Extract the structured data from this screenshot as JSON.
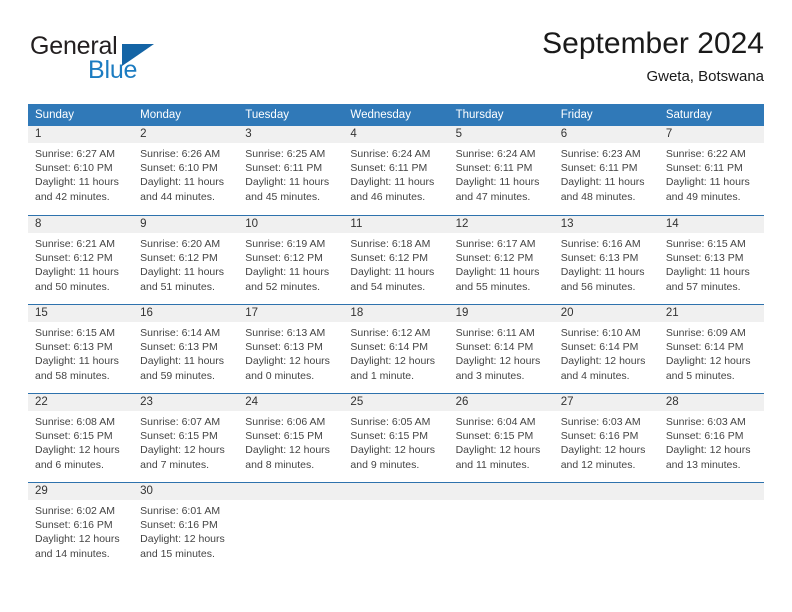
{
  "brand": {
    "name_part1": "General",
    "name_part2": "Blue",
    "triangle_color": "#1464a5",
    "blue_text_color": "#1c7cc1"
  },
  "header": {
    "title": "September 2024",
    "subtitle": "Gweta, Botswana"
  },
  "theme": {
    "header_blue": "#3079b8",
    "row_rule_blue": "#2e72ad",
    "day_band_gray": "#f0f0f0"
  },
  "weekdays": [
    "Sunday",
    "Monday",
    "Tuesday",
    "Wednesday",
    "Thursday",
    "Friday",
    "Saturday"
  ],
  "weeks": [
    [
      {
        "day": "1",
        "l1": "Sunrise: 6:27 AM",
        "l2": "Sunset: 6:10 PM",
        "l3": "Daylight: 11 hours",
        "l4": "and 42 minutes."
      },
      {
        "day": "2",
        "l1": "Sunrise: 6:26 AM",
        "l2": "Sunset: 6:10 PM",
        "l3": "Daylight: 11 hours",
        "l4": "and 44 minutes."
      },
      {
        "day": "3",
        "l1": "Sunrise: 6:25 AM",
        "l2": "Sunset: 6:11 PM",
        "l3": "Daylight: 11 hours",
        "l4": "and 45 minutes."
      },
      {
        "day": "4",
        "l1": "Sunrise: 6:24 AM",
        "l2": "Sunset: 6:11 PM",
        "l3": "Daylight: 11 hours",
        "l4": "and 46 minutes."
      },
      {
        "day": "5",
        "l1": "Sunrise: 6:24 AM",
        "l2": "Sunset: 6:11 PM",
        "l3": "Daylight: 11 hours",
        "l4": "and 47 minutes."
      },
      {
        "day": "6",
        "l1": "Sunrise: 6:23 AM",
        "l2": "Sunset: 6:11 PM",
        "l3": "Daylight: 11 hours",
        "l4": "and 48 minutes."
      },
      {
        "day": "7",
        "l1": "Sunrise: 6:22 AM",
        "l2": "Sunset: 6:11 PM",
        "l3": "Daylight: 11 hours",
        "l4": "and 49 minutes."
      }
    ],
    [
      {
        "day": "8",
        "l1": "Sunrise: 6:21 AM",
        "l2": "Sunset: 6:12 PM",
        "l3": "Daylight: 11 hours",
        "l4": "and 50 minutes."
      },
      {
        "day": "9",
        "l1": "Sunrise: 6:20 AM",
        "l2": "Sunset: 6:12 PM",
        "l3": "Daylight: 11 hours",
        "l4": "and 51 minutes."
      },
      {
        "day": "10",
        "l1": "Sunrise: 6:19 AM",
        "l2": "Sunset: 6:12 PM",
        "l3": "Daylight: 11 hours",
        "l4": "and 52 minutes."
      },
      {
        "day": "11",
        "l1": "Sunrise: 6:18 AM",
        "l2": "Sunset: 6:12 PM",
        "l3": "Daylight: 11 hours",
        "l4": "and 54 minutes."
      },
      {
        "day": "12",
        "l1": "Sunrise: 6:17 AM",
        "l2": "Sunset: 6:12 PM",
        "l3": "Daylight: 11 hours",
        "l4": "and 55 minutes."
      },
      {
        "day": "13",
        "l1": "Sunrise: 6:16 AM",
        "l2": "Sunset: 6:13 PM",
        "l3": "Daylight: 11 hours",
        "l4": "and 56 minutes."
      },
      {
        "day": "14",
        "l1": "Sunrise: 6:15 AM",
        "l2": "Sunset: 6:13 PM",
        "l3": "Daylight: 11 hours",
        "l4": "and 57 minutes."
      }
    ],
    [
      {
        "day": "15",
        "l1": "Sunrise: 6:15 AM",
        "l2": "Sunset: 6:13 PM",
        "l3": "Daylight: 11 hours",
        "l4": "and 58 minutes."
      },
      {
        "day": "16",
        "l1": "Sunrise: 6:14 AM",
        "l2": "Sunset: 6:13 PM",
        "l3": "Daylight: 11 hours",
        "l4": "and 59 minutes."
      },
      {
        "day": "17",
        "l1": "Sunrise: 6:13 AM",
        "l2": "Sunset: 6:13 PM",
        "l3": "Daylight: 12 hours",
        "l4": "and 0 minutes."
      },
      {
        "day": "18",
        "l1": "Sunrise: 6:12 AM",
        "l2": "Sunset: 6:14 PM",
        "l3": "Daylight: 12 hours",
        "l4": "and 1 minute."
      },
      {
        "day": "19",
        "l1": "Sunrise: 6:11 AM",
        "l2": "Sunset: 6:14 PM",
        "l3": "Daylight: 12 hours",
        "l4": "and 3 minutes."
      },
      {
        "day": "20",
        "l1": "Sunrise: 6:10 AM",
        "l2": "Sunset: 6:14 PM",
        "l3": "Daylight: 12 hours",
        "l4": "and 4 minutes."
      },
      {
        "day": "21",
        "l1": "Sunrise: 6:09 AM",
        "l2": "Sunset: 6:14 PM",
        "l3": "Daylight: 12 hours",
        "l4": "and 5 minutes."
      }
    ],
    [
      {
        "day": "22",
        "l1": "Sunrise: 6:08 AM",
        "l2": "Sunset: 6:15 PM",
        "l3": "Daylight: 12 hours",
        "l4": "and 6 minutes."
      },
      {
        "day": "23",
        "l1": "Sunrise: 6:07 AM",
        "l2": "Sunset: 6:15 PM",
        "l3": "Daylight: 12 hours",
        "l4": "and 7 minutes."
      },
      {
        "day": "24",
        "l1": "Sunrise: 6:06 AM",
        "l2": "Sunset: 6:15 PM",
        "l3": "Daylight: 12 hours",
        "l4": "and 8 minutes."
      },
      {
        "day": "25",
        "l1": "Sunrise: 6:05 AM",
        "l2": "Sunset: 6:15 PM",
        "l3": "Daylight: 12 hours",
        "l4": "and 9 minutes."
      },
      {
        "day": "26",
        "l1": "Sunrise: 6:04 AM",
        "l2": "Sunset: 6:15 PM",
        "l3": "Daylight: 12 hours",
        "l4": "and 11 minutes."
      },
      {
        "day": "27",
        "l1": "Sunrise: 6:03 AM",
        "l2": "Sunset: 6:16 PM",
        "l3": "Daylight: 12 hours",
        "l4": "and 12 minutes."
      },
      {
        "day": "28",
        "l1": "Sunrise: 6:03 AM",
        "l2": "Sunset: 6:16 PM",
        "l3": "Daylight: 12 hours",
        "l4": "and 13 minutes."
      }
    ],
    [
      {
        "day": "29",
        "l1": "Sunrise: 6:02 AM",
        "l2": "Sunset: 6:16 PM",
        "l3": "Daylight: 12 hours",
        "l4": "and 14 minutes."
      },
      {
        "day": "30",
        "l1": "Sunrise: 6:01 AM",
        "l2": "Sunset: 6:16 PM",
        "l3": "Daylight: 12 hours",
        "l4": "and 15 minutes."
      },
      {
        "day": "",
        "l1": "",
        "l2": "",
        "l3": "",
        "l4": ""
      },
      {
        "day": "",
        "l1": "",
        "l2": "",
        "l3": "",
        "l4": ""
      },
      {
        "day": "",
        "l1": "",
        "l2": "",
        "l3": "",
        "l4": ""
      },
      {
        "day": "",
        "l1": "",
        "l2": "",
        "l3": "",
        "l4": ""
      },
      {
        "day": "",
        "l1": "",
        "l2": "",
        "l3": "",
        "l4": ""
      }
    ]
  ]
}
